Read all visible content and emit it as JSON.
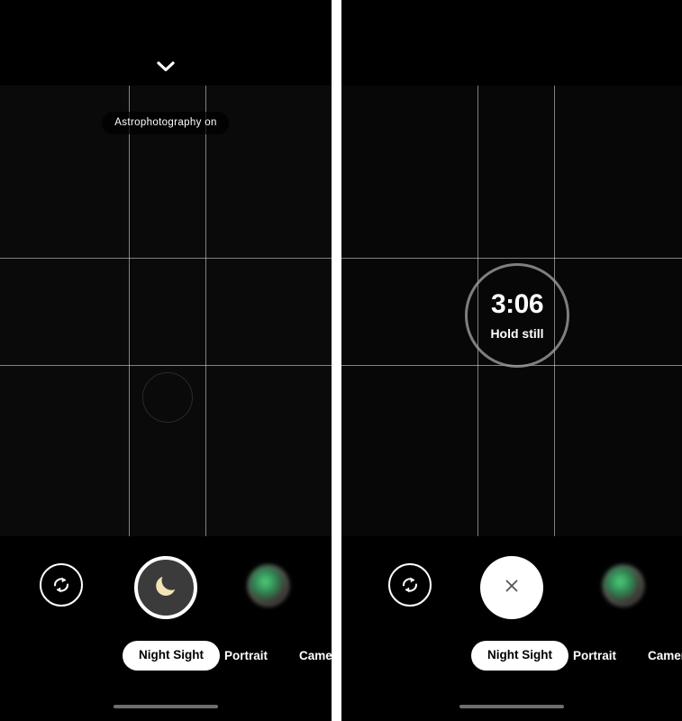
{
  "meta": {
    "app": "Pixel Camera",
    "scene": "Night Sight astrophotography capture — before and during exposure"
  },
  "colors": {
    "background": "#000000",
    "viewfinder": "#0a0a0a",
    "accent_white": "#ffffff",
    "shutter_fill": "#3b3b3b",
    "moon": "#f2e4b4",
    "grid_line": "#e6e6e6",
    "ring_gray": "#a0a0a0",
    "home_indicator": "#6e6e6e",
    "page_gap": "#ffffff"
  },
  "panels": [
    {
      "id": "left",
      "name": "ready-state",
      "top": {
        "chevron_icon": "chevron-down-icon",
        "chevron_visible": true
      },
      "viewfinder": {
        "grid": "3x3",
        "grid_visible": true,
        "status_pill": "Astrophotography on",
        "status_pill_visible": true,
        "idle_ring_visible": true,
        "timer_visible": false
      },
      "controls": {
        "flip_camera_icon": "switch-camera-icon",
        "shutter_type": "night-sight-moon",
        "shutter_icon": "crescent-moon-icon",
        "gallery_thumbnail": "gallery-thumbnail"
      },
      "modes": [
        {
          "label": "Night Sight",
          "active": true
        },
        {
          "label": "Portrait",
          "active": false
        },
        {
          "label": "Camer",
          "active": false
        }
      ]
    },
    {
      "id": "right",
      "name": "capturing-state",
      "top": {
        "chevron_icon": "chevron-down-icon",
        "chevron_visible": false
      },
      "viewfinder": {
        "grid": "3x3",
        "grid_visible": true,
        "status_pill": "",
        "status_pill_visible": false,
        "idle_ring_visible": false,
        "timer_visible": true,
        "timer": {
          "countdown": "3:06",
          "hint": "Hold still"
        }
      },
      "controls": {
        "flip_camera_icon": "switch-camera-icon",
        "shutter_type": "stop-capture",
        "shutter_icon": "close-x-icon",
        "gallery_thumbnail": "gallery-thumbnail"
      },
      "modes": [
        {
          "label": "Night Sight",
          "active": true
        },
        {
          "label": "Portrait",
          "active": false
        },
        {
          "label": "Camer",
          "active": false
        }
      ]
    }
  ]
}
